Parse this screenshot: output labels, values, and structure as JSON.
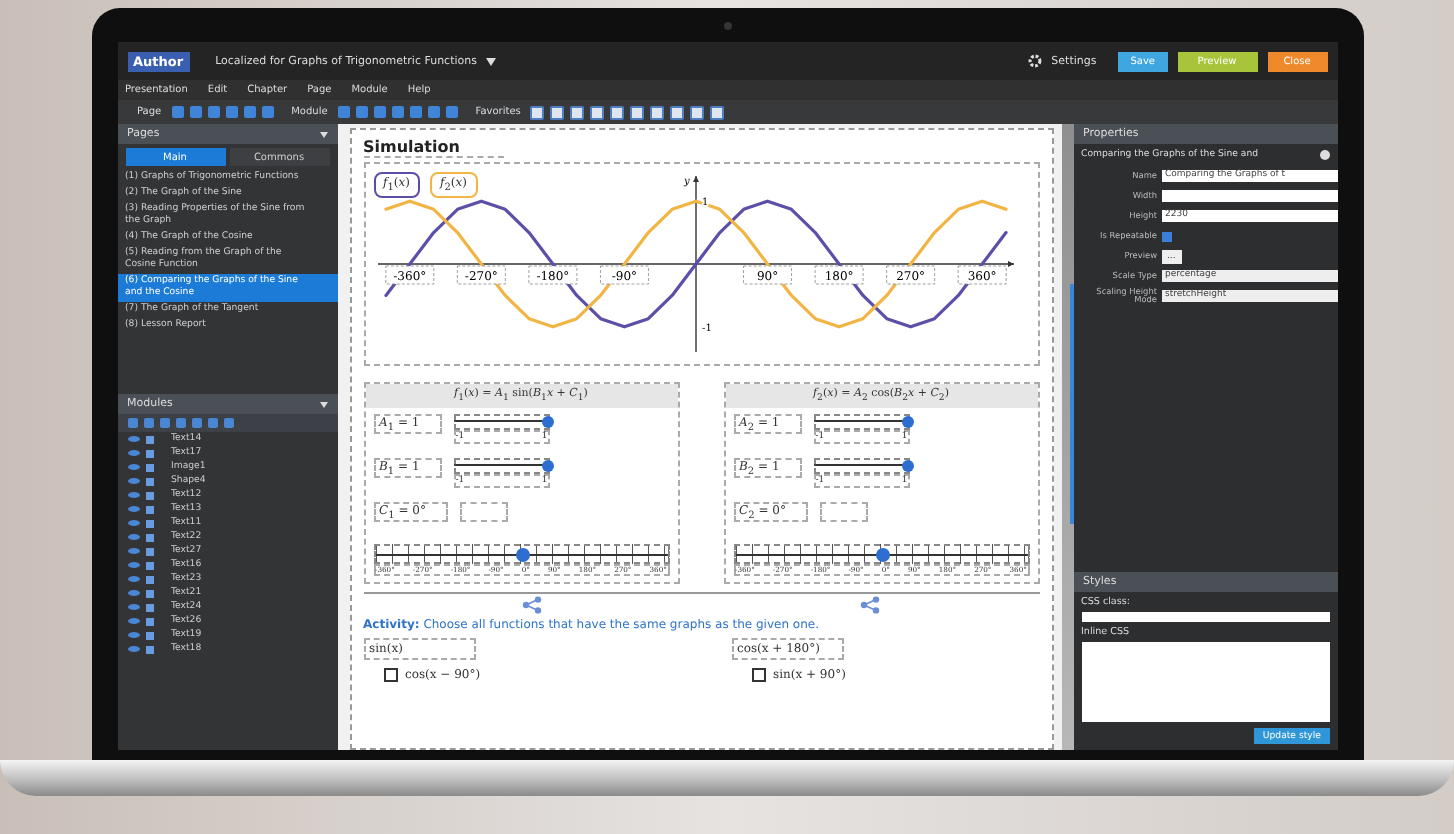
{
  "app": {
    "logo": "Author",
    "title": "Localized for Graphs of Trigonometric Functions",
    "settings": "Settings",
    "buttons": [
      {
        "label": "Save",
        "kind": "save"
      },
      {
        "label": "Preview",
        "kind": "preview"
      },
      {
        "label": "Close",
        "kind": "close"
      }
    ]
  },
  "menu": [
    "Presentation",
    "Edit",
    "Chapter",
    "Page",
    "Module",
    "Help"
  ],
  "toolbar": [
    "Page",
    "Module",
    "Favorites"
  ],
  "pages_panel": {
    "title": "Pages",
    "tabs": [
      {
        "label": "Main",
        "selected": true
      },
      {
        "label": "Commons",
        "selected": false
      }
    ],
    "items": [
      {
        "label": "(1) Graphs of Trigonometric Functions",
        "selected": false
      },
      {
        "label": "(2) The Graph of the Sine",
        "selected": false
      },
      {
        "label": "(3) Reading Properties of the Sine from the Graph",
        "selected": false
      },
      {
        "label": "(4) The Graph of the Cosine",
        "selected": false
      },
      {
        "label": "(5) Reading from the Graph of the Cosine Function",
        "selected": false
      },
      {
        "label": "(6) Comparing the Graphs of the Sine and the Cosine",
        "selected": true
      },
      {
        "label": "(7) The Graph of the Tangent",
        "selected": false
      },
      {
        "label": "(8) Lesson Report",
        "selected": false
      }
    ]
  },
  "modules_panel": {
    "title": "Modules",
    "items": [
      "Text14",
      "Text17",
      "Image1",
      "Shape4",
      "Text12",
      "Text13",
      "Text11",
      "Text22",
      "Text27",
      "Text16",
      "Text23",
      "Text21",
      "Text24",
      "Text26",
      "Text19",
      "Text18"
    ]
  },
  "page": {
    "title": "Simulation",
    "chart_data": {
      "type": "line",
      "ylabel": "y",
      "x": [
        -390,
        -360,
        -330,
        -300,
        -270,
        -240,
        -210,
        -180,
        -150,
        -120,
        -90,
        -60,
        -30,
        0,
        30,
        60,
        90,
        120,
        150,
        180,
        210,
        240,
        270,
        300,
        330,
        360,
        390
      ],
      "series": [
        {
          "name": "*f*$_{1}$(*x*)",
          "color": "#5b4fa8",
          "values": [
            -0.5,
            0,
            0.5,
            0.87,
            1,
            0.87,
            0.5,
            0,
            -0.5,
            -0.87,
            -1,
            -0.87,
            -0.5,
            0,
            0.5,
            0.87,
            1,
            0.87,
            0.5,
            0,
            -0.5,
            -0.87,
            -1,
            -0.87,
            -0.5,
            0,
            0.5
          ]
        },
        {
          "name": "*f*$_{2}$(*x*)",
          "color": "#f2b544",
          "values": [
            0.87,
            1,
            0.87,
            0.5,
            0,
            -0.5,
            -0.87,
            -1,
            -0.87,
            -0.5,
            0,
            0.5,
            0.87,
            1,
            0.87,
            0.5,
            0,
            -0.5,
            -0.87,
            -1,
            -0.87,
            -0.5,
            0,
            0.5,
            0.87,
            1,
            0.87
          ]
        }
      ],
      "xlim": [
        -400,
        400
      ],
      "ylim": [
        -1.4,
        1.4
      ],
      "xticks": [
        {
          "value": -360,
          "label": "-360°"
        },
        {
          "value": -270,
          "label": "-270°"
        },
        {
          "value": -180,
          "label": "-180°"
        },
        {
          "value": -90,
          "label": "-90°"
        },
        {
          "value": 90,
          "label": "90°"
        },
        {
          "value": 180,
          "label": "180°"
        },
        {
          "value": 270,
          "label": "270°"
        },
        {
          "value": 360,
          "label": "360°"
        }
      ],
      "yticks": [
        {
          "value": 1,
          "label": "1"
        },
        {
          "value": -1,
          "label": "-1"
        }
      ]
    },
    "formulas": [
      {
        "formula": "*f*$_{1}$(*x*) = *A*$_{1}$ sin(*B*$_{1}$*x* + *C*$_{1}$)",
        "params": [
          {
            "label": "*A*$_{1}$ = 1",
            "kind": "slider",
            "level": 1,
            "min": "-1",
            "max": "1"
          },
          {
            "label": "*B*$_{1}$ = 1",
            "kind": "slider",
            "level": 1,
            "min": "-1",
            "max": "1"
          },
          {
            "label": "*C*$_{1}$ = 0°",
            "kind": "angle"
          }
        ],
        "angle_slider": {
          "level": 0.5,
          "ticks": [
            "-360°",
            "-270°",
            "-180°",
            "-90°",
            "0°",
            "90°",
            "180°",
            "270°",
            "360°"
          ]
        }
      },
      {
        "formula": "*f*$_{2}$(*x*) = *A*$_{2}$ cos(*B*$_{2}$*x* + *C*$_{2}$)",
        "params": [
          {
            "label": "*A*$_{2}$ = 1",
            "kind": "slider",
            "level": 1,
            "min": "-1",
            "max": "1"
          },
          {
            "label": "*B*$_{2}$ = 1",
            "kind": "slider",
            "level": 1,
            "min": "-1",
            "max": "1"
          },
          {
            "label": "*C*$_{2}$ = 0°",
            "kind": "angle"
          }
        ],
        "angle_slider": {
          "level": 0.5,
          "ticks": [
            "-360°",
            "-270°",
            "-180°",
            "-90°",
            "0°",
            "90°",
            "180°",
            "270°",
            "360°"
          ]
        }
      }
    ],
    "activity": {
      "text": "**Activity:** Choose all functions that have the same graphs as the given one.",
      "groups": [
        {
          "given": "sin(x)",
          "options": [
            {
              "label": "cos(x − 90°)",
              "checked": false
            }
          ]
        },
        {
          "given": "cos(x + 180°)",
          "options": [
            {
              "label": "sin(x + 90°)",
              "checked": false
            }
          ]
        }
      ]
    }
  },
  "properties": {
    "title": "Properties",
    "subtitle": "Comparing the Graphs of the Sine and",
    "fields": [
      {
        "label": "Name",
        "kind": "text",
        "value": "Comparing the Graphs of t"
      },
      {
        "label": "Width",
        "kind": "text"
      },
      {
        "label": "Height",
        "kind": "text",
        "value": "2230"
      },
      {
        "label": "Is Repeatable",
        "kind": "checkbox",
        "checked": true
      },
      {
        "label": "Preview",
        "kind": "button",
        "value": "..."
      },
      {
        "label": "Scale Type",
        "kind": "select",
        "value": "percentage"
      },
      {
        "label": "Scaling Height Mode",
        "kind": "select",
        "value": "stretchHeight"
      }
    ]
  },
  "styles": {
    "title": "Styles",
    "css_label": "CSS class:",
    "inline_label": "Inline CSS",
    "button": "Update style"
  }
}
